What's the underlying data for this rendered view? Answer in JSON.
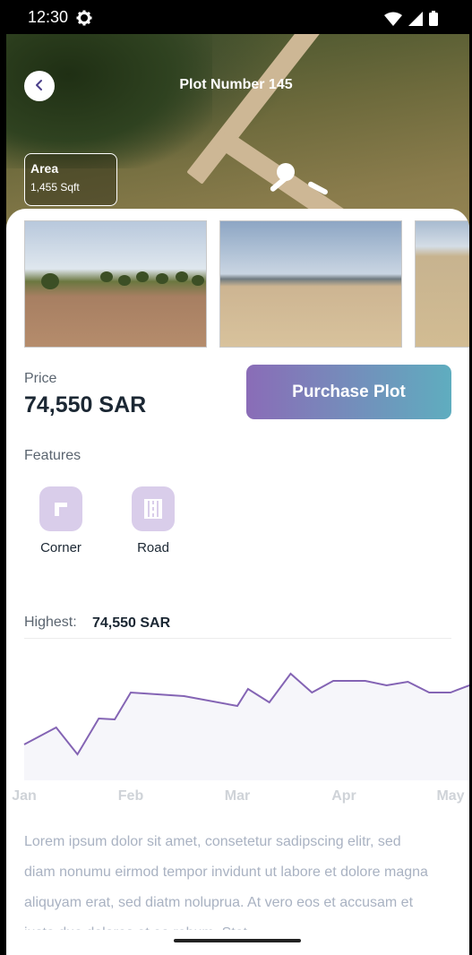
{
  "status_bar": {
    "time": "12:30"
  },
  "header": {
    "title": "Plot Number 145",
    "back_icon": "chevron-left-icon"
  },
  "area_badge": {
    "label": "Area",
    "value": "1,455  Sqft"
  },
  "gallery": {
    "images": [
      "plot-photo-1",
      "plot-photo-2",
      "plot-photo-3"
    ]
  },
  "price": {
    "label": "Price",
    "value": "74,550 SAR"
  },
  "purchase_button": {
    "label": "Purchase Plot",
    "gradient_start": "#8a6cb7",
    "gradient_end": "#5fadbf"
  },
  "features": {
    "label": "Features",
    "items": [
      {
        "label": "Corner",
        "icon": "corner-icon"
      },
      {
        "label": "Road",
        "icon": "road-icon"
      }
    ]
  },
  "highest": {
    "label": "Highest:",
    "value": "74,550 SAR"
  },
  "chart_data": {
    "type": "area",
    "x_ticks": [
      "Jan",
      "Feb",
      "Mar",
      "Apr",
      "May"
    ],
    "x": [
      0,
      0.3,
      0.5,
      0.7,
      0.85,
      1,
      1.5,
      2,
      2.1,
      2.3,
      2.5,
      2.7,
      2.9,
      3,
      3.2,
      3.4,
      3.6,
      3.8,
      4,
      4.2
    ],
    "values": [
      40,
      59,
      29,
      69,
      68,
      98,
      94,
      83,
      102,
      87,
      119,
      98,
      111,
      111,
      111,
      106,
      110,
      98,
      98,
      107
    ],
    "line_color": "#8464b4",
    "fill_color": "#f6f6fa",
    "grid": false
  },
  "description": {
    "lines": [
      "Lorem ipsum dolor sit amet, consetetur sadipscing elitr, sed",
      "diam nonumu eirmod tempor invidunt ut labore et dolore magna",
      "aliquyam erat, sed diatm noluprua. At vero eos et accusam et",
      "justo duo dolores et ea rebum. Stet"
    ]
  }
}
